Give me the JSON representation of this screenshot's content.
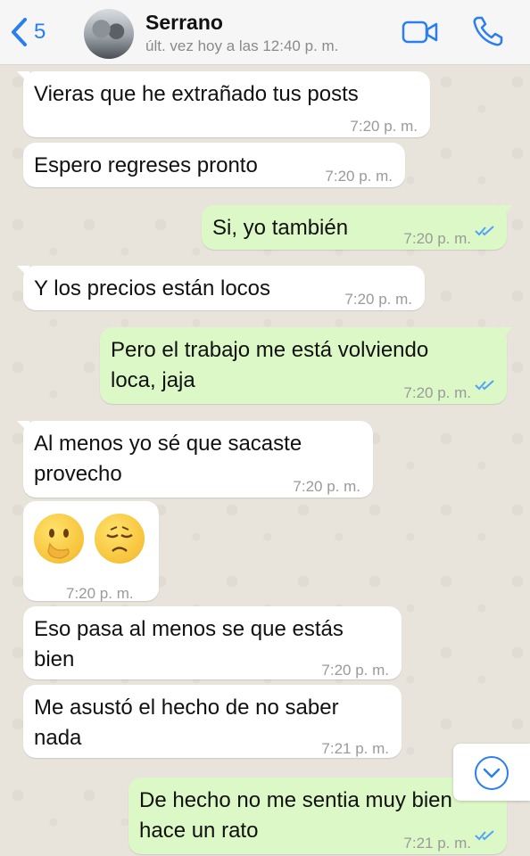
{
  "header": {
    "back_count": "5",
    "contact_name": "Serrano",
    "last_seen": "últ. vez hoy a las 12:40 p. m."
  },
  "messages": [
    {
      "direction": "in",
      "text": "Vieras que he extrañado tus posts",
      "time": "7:20 p. m."
    },
    {
      "direction": "in",
      "text": "Espero regreses pronto",
      "time": "7:20 p. m."
    },
    {
      "direction": "out",
      "text": "Si, yo también",
      "time": "7:20 p. m.",
      "status": "read"
    },
    {
      "direction": "in",
      "text": "Y los precios están locos",
      "time": "7:20 p. m."
    },
    {
      "direction": "out",
      "lines": [
        "Pero el trabajo me está volviendo",
        "loca, jaja"
      ],
      "time": "7:20 p. m.",
      "status": "read"
    },
    {
      "direction": "in",
      "lines": [
        "Al menos yo sé que sacaste",
        "provecho"
      ],
      "time": "7:20 p. m."
    },
    {
      "direction": "in",
      "emojis": [
        "face-with-hand-over-mouth",
        "disappointed-face"
      ],
      "time": "7:20 p. m."
    },
    {
      "direction": "in",
      "lines": [
        "Eso pasa al menos se que estás",
        "bien"
      ],
      "time": "7:20 p. m."
    },
    {
      "direction": "in",
      "lines": [
        "Me asustó el hecho de no saber",
        "nada"
      ],
      "time": "7:21 p. m."
    },
    {
      "direction": "out",
      "lines": [
        "De hecho no me sentia muy bien",
        "hace un rato"
      ],
      "time": "7:21 p. m.",
      "status": "read"
    }
  ],
  "colors": {
    "accent": "#2a7ef0",
    "incoming_bubble": "#ffffff",
    "outgoing_bubble": "#dcf8c6",
    "read_ticks": "#4fa3f7"
  }
}
